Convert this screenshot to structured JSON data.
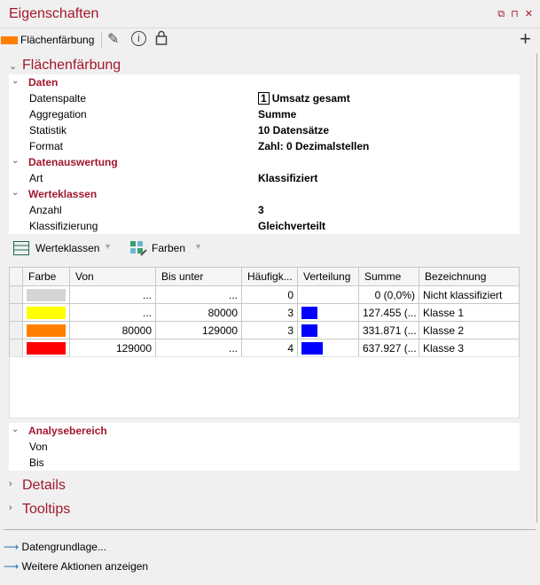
{
  "window": {
    "title": "Eigenschaften",
    "controls": "⧉ ⊓ ✕"
  },
  "toolbar": {
    "label": "Flächenfärbung"
  },
  "sections": {
    "fill": "Flächenfärbung",
    "details": "Details",
    "tooltips": "Tooltips"
  },
  "daten": {
    "group": "Daten",
    "rows": [
      {
        "k": "Datenspalte",
        "badge": "1",
        "v": "Umsatz gesamt"
      },
      {
        "k": "Aggregation",
        "v": "Summe"
      },
      {
        "k": "Statistik",
        "v": "10 Datensätze"
      },
      {
        "k": "Format",
        "v": "Zahl: 0 Dezimalstellen"
      }
    ]
  },
  "auswertung": {
    "group": "Datenauswertung",
    "rows": [
      {
        "k": "Art",
        "v": "Klassifiziert"
      }
    ]
  },
  "werteklassen": {
    "group": "Werteklassen",
    "rows": [
      {
        "k": "Anzahl",
        "v": "3"
      },
      {
        "k": "Klassifizierung",
        "v": "Gleichverteilt"
      }
    ]
  },
  "classtools": {
    "werteklassen": "Werteklassen",
    "farben": "Farben"
  },
  "table": {
    "headers": [
      "Farbe",
      "Von",
      "Bis unter",
      "Häufigk...",
      "Verteilung",
      "Summe",
      "Bezeichnung"
    ],
    "rows": [
      {
        "color": "#d4d4d4",
        "von": "...",
        "bis": "...",
        "count": "0",
        "dist": 0,
        "summe": "0 (0,0%)",
        "name": "Nicht klassifiziert"
      },
      {
        "color": "#ffff00",
        "von": "...",
        "bis": "80000",
        "count": "3",
        "dist": 3,
        "summe": "127.455 (...",
        "name": "Klasse 1"
      },
      {
        "color": "#ff8000",
        "von": "80000",
        "bis": "129000",
        "count": "3",
        "dist": 3,
        "summe": "331.871 (...",
        "name": "Klasse 2"
      },
      {
        "color": "#ff0000",
        "von": "129000",
        "bis": "...",
        "count": "4",
        "dist": 4,
        "summe": "637.927 (...",
        "name": "Klasse 3"
      }
    ]
  },
  "analyse": {
    "group": "Analysebereich",
    "rows": [
      {
        "k": "Von",
        "v": ""
      },
      {
        "k": "Bis",
        "v": ""
      }
    ]
  },
  "links": {
    "datengrundlage": "Datengrundlage...",
    "weitere": "Weitere Aktionen anzeigen"
  }
}
